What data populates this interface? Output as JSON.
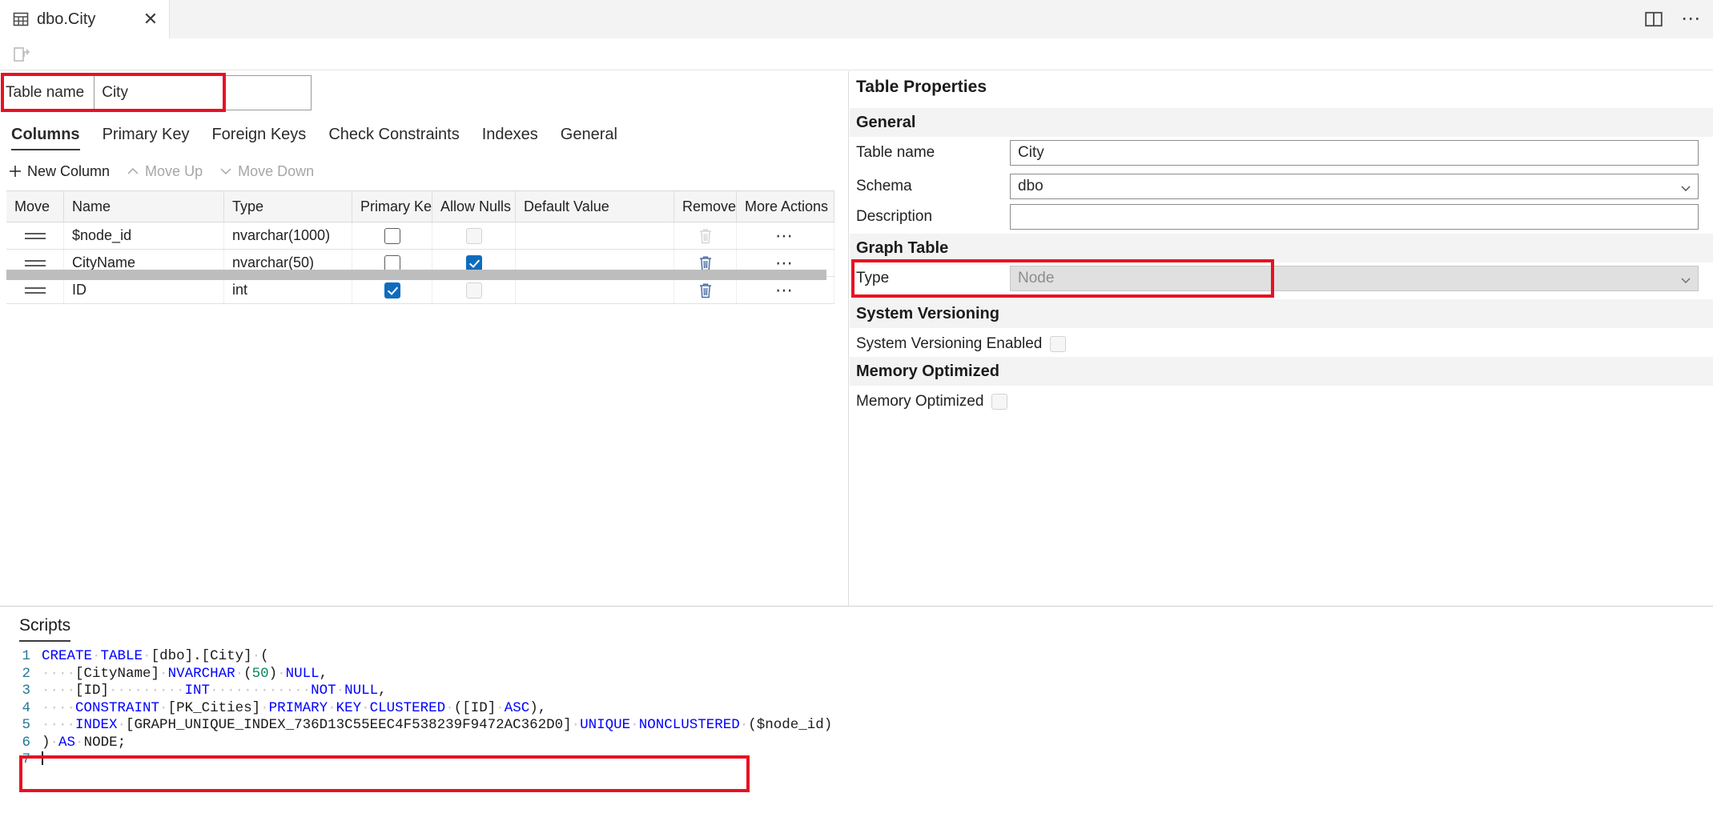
{
  "window": {
    "tab": {
      "label": "dbo.City",
      "icon": "table-icon",
      "close_label": "✕"
    },
    "controls": {
      "split_editor": "split-editor-icon",
      "more": "⋯"
    }
  },
  "designer_toolbar": {
    "publish_icon": "publish-changes-icon"
  },
  "editor": {
    "table_name_label": "Table name",
    "table_name_value": "City",
    "tabs": [
      {
        "label": "Columns",
        "active": true
      },
      {
        "label": "Primary Key",
        "active": false
      },
      {
        "label": "Foreign Keys",
        "active": false
      },
      {
        "label": "Check Constraints",
        "active": false
      },
      {
        "label": "Indexes",
        "active": false
      },
      {
        "label": "General",
        "active": false
      }
    ],
    "commands": [
      {
        "label": "New Column",
        "icon": "plus-icon",
        "disabled": false
      },
      {
        "label": "Move Up",
        "icon": "chevron-up-icon",
        "disabled": true
      },
      {
        "label": "Move Down",
        "icon": "chevron-down-icon",
        "disabled": true
      }
    ],
    "grid": {
      "columns": [
        "Move",
        "Name",
        "Type",
        "Primary Key",
        "Allow Nulls",
        "Default Value",
        "Remove",
        "More Actions"
      ],
      "rows": [
        {
          "name": "$node_id",
          "type": "nvarchar(1000)",
          "primary_key": false,
          "pk_disabled": false,
          "allow_nulls": false,
          "nulls_disabled": true,
          "default_value": "",
          "remove_disabled": true
        },
        {
          "name": "CityName",
          "type": "nvarchar(50)",
          "primary_key": false,
          "pk_disabled": false,
          "allow_nulls": true,
          "nulls_disabled": false,
          "default_value": "",
          "remove_disabled": false
        },
        {
          "name": "ID",
          "type": "int",
          "primary_key": true,
          "pk_disabled": false,
          "allow_nulls": false,
          "nulls_disabled": true,
          "default_value": "",
          "remove_disabled": false
        }
      ]
    }
  },
  "properties": {
    "title": "Table Properties",
    "sections": {
      "general": {
        "heading": "General",
        "table_name_label": "Table name",
        "table_name_value": "City",
        "schema_label": "Schema",
        "schema_value": "dbo",
        "description_label": "Description",
        "description_value": ""
      },
      "graph_table": {
        "heading": "Graph Table",
        "type_label": "Type",
        "type_value": "Node"
      },
      "system_versioning": {
        "heading": "System Versioning",
        "enabled_label": "System Versioning Enabled",
        "enabled": false
      },
      "memory_optimized": {
        "heading": "Memory Optimized",
        "label": "Memory Optimized",
        "enabled": false
      }
    }
  },
  "scripts": {
    "title": "Scripts",
    "lines": [
      {
        "no": "1",
        "segments": [
          {
            "t": "CREATE",
            "c": "k"
          },
          {
            "t": "·",
            "c": "d"
          },
          {
            "t": "TABLE",
            "c": "k"
          },
          {
            "t": "·",
            "c": "d"
          },
          {
            "t": "[dbo].[City]",
            "c": "p"
          },
          {
            "t": "·",
            "c": "d"
          },
          {
            "t": "(",
            "c": "p"
          }
        ]
      },
      {
        "no": "2",
        "segments": [
          {
            "t": "····",
            "c": "d"
          },
          {
            "t": "[CityName]",
            "c": "p"
          },
          {
            "t": "·",
            "c": "d"
          },
          {
            "t": "NVARCHAR",
            "c": "k"
          },
          {
            "t": "·",
            "c": "d"
          },
          {
            "t": "(",
            "c": "p"
          },
          {
            "t": "50",
            "c": "n"
          },
          {
            "t": ")",
            "c": "p"
          },
          {
            "t": "·",
            "c": "d"
          },
          {
            "t": "NULL",
            "c": "k"
          },
          {
            "t": ",",
            "c": "p"
          }
        ]
      },
      {
        "no": "3",
        "segments": [
          {
            "t": "····",
            "c": "d"
          },
          {
            "t": "[ID]",
            "c": "p"
          },
          {
            "t": "·········",
            "c": "d"
          },
          {
            "t": "INT",
            "c": "k"
          },
          {
            "t": "············",
            "c": "d"
          },
          {
            "t": "NOT",
            "c": "k"
          },
          {
            "t": "·",
            "c": "d"
          },
          {
            "t": "NULL",
            "c": "k"
          },
          {
            "t": ",",
            "c": "p"
          }
        ]
      },
      {
        "no": "4",
        "segments": [
          {
            "t": "····",
            "c": "d"
          },
          {
            "t": "CONSTRAINT",
            "c": "k"
          },
          {
            "t": "·",
            "c": "d"
          },
          {
            "t": "[PK_Cities]",
            "c": "p"
          },
          {
            "t": "·",
            "c": "d"
          },
          {
            "t": "PRIMARY",
            "c": "k"
          },
          {
            "t": "·",
            "c": "d"
          },
          {
            "t": "KEY",
            "c": "k"
          },
          {
            "t": "·",
            "c": "d"
          },
          {
            "t": "CLUSTERED",
            "c": "k"
          },
          {
            "t": "·",
            "c": "d"
          },
          {
            "t": "([ID]",
            "c": "p"
          },
          {
            "t": "·",
            "c": "d"
          },
          {
            "t": "ASC",
            "c": "k"
          },
          {
            "t": "),",
            "c": "p"
          }
        ]
      },
      {
        "no": "5",
        "segments": [
          {
            "t": "····",
            "c": "d"
          },
          {
            "t": "INDEX",
            "c": "k"
          },
          {
            "t": "·",
            "c": "d"
          },
          {
            "t": "[GRAPH_UNIQUE_INDEX_736D13C55EEC4F538239F9472AC362D0]",
            "c": "p"
          },
          {
            "t": "·",
            "c": "d"
          },
          {
            "t": "UNIQUE",
            "c": "k"
          },
          {
            "t": "·",
            "c": "d"
          },
          {
            "t": "NONCLUSTERED",
            "c": "k"
          },
          {
            "t": "·",
            "c": "d"
          },
          {
            "t": "($node_id)",
            "c": "p"
          }
        ]
      },
      {
        "no": "6",
        "segments": [
          {
            "t": ")",
            "c": "p"
          },
          {
            "t": "·",
            "c": "d"
          },
          {
            "t": "AS",
            "c": "k"
          },
          {
            "t": "·",
            "c": "d"
          },
          {
            "t": "NODE;",
            "c": "p"
          }
        ]
      },
      {
        "no": "7",
        "segments": []
      }
    ]
  },
  "colors": {
    "highlight": "#e81123",
    "accent_checkbox": "#0f6cbd",
    "keyword": "#0000ff",
    "number": "#098658",
    "line_number": "#237893"
  }
}
